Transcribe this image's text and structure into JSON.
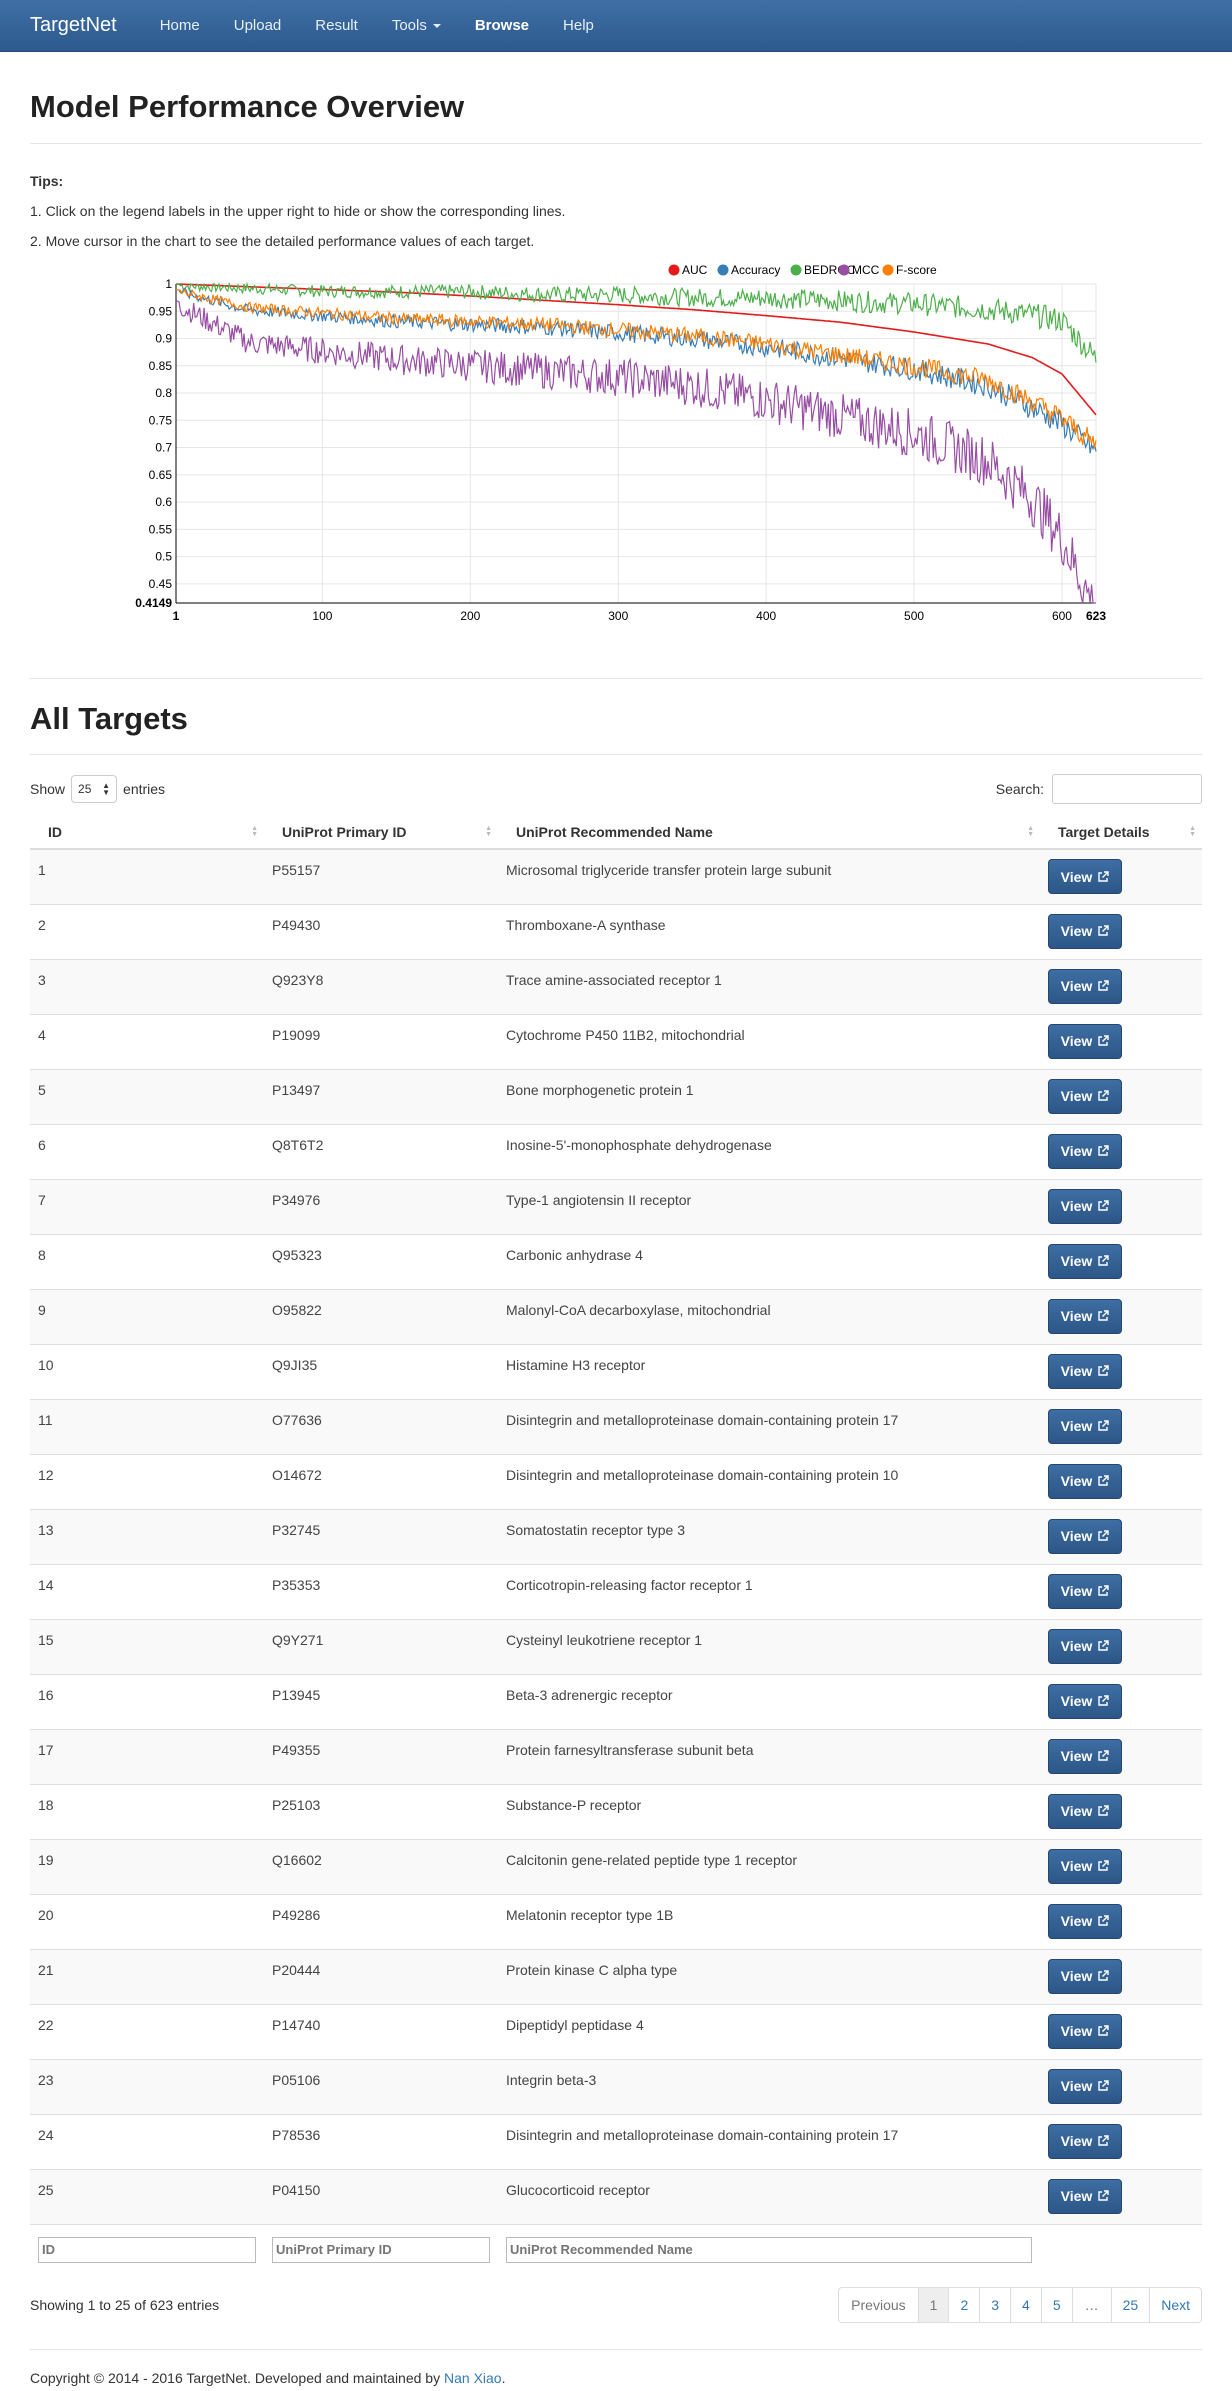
{
  "navbar": {
    "brand": "TargetNet",
    "items": [
      {
        "label": "Home"
      },
      {
        "label": "Upload"
      },
      {
        "label": "Result"
      },
      {
        "label": "Tools"
      },
      {
        "label": "Browse"
      },
      {
        "label": "Help"
      }
    ]
  },
  "overview": {
    "title": "Model Performance Overview",
    "tips_heading": "Tips:",
    "tips": [
      "1. Click on the legend labels in the upper right to hide or show the corresponding lines.",
      "2. Move cursor in the chart to see the detailed performance values of each target."
    ]
  },
  "chart_data": {
    "type": "line",
    "title": "",
    "xlabel": "",
    "ylabel": "",
    "x_range": [
      1,
      623
    ],
    "ylim": [
      0.4149,
      1
    ],
    "x_ticks": [
      "1",
      "100",
      "200",
      "300",
      "400",
      "500",
      "600",
      "623"
    ],
    "y_ticks": [
      "0.4149",
      "0.45",
      "0.5",
      "0.55",
      "0.6",
      "0.65",
      "0.7",
      "0.75",
      "0.8",
      "0.85",
      "0.9",
      "0.95",
      "1"
    ],
    "legend_position": "top-right",
    "grid": true,
    "series": [
      {
        "name": "AUC",
        "color": "#e41a1c",
        "x": [
          1,
          50,
          100,
          150,
          200,
          250,
          300,
          350,
          400,
          450,
          500,
          550,
          580,
          600,
          623
        ],
        "values": [
          1.0,
          0.995,
          0.99,
          0.985,
          0.978,
          0.97,
          0.962,
          0.953,
          0.942,
          0.93,
          0.912,
          0.89,
          0.865,
          0.835,
          0.76
        ]
      },
      {
        "name": "Accuracy",
        "color": "#377eb8",
        "x": [
          1,
          50,
          100,
          150,
          200,
          250,
          300,
          350,
          400,
          450,
          500,
          550,
          580,
          600,
          623
        ],
        "values": [
          0.99,
          0.955,
          0.945,
          0.935,
          0.93,
          0.925,
          0.915,
          0.905,
          0.89,
          0.87,
          0.85,
          0.82,
          0.78,
          0.75,
          0.7
        ]
      },
      {
        "name": "BEDROC",
        "color": "#4daf4a",
        "x": [
          1,
          50,
          100,
          150,
          200,
          250,
          300,
          350,
          400,
          450,
          500,
          550,
          580,
          600,
          623
        ],
        "values": [
          1.0,
          0.995,
          0.99,
          0.99,
          0.99,
          0.985,
          0.985,
          0.98,
          0.98,
          0.975,
          0.97,
          0.96,
          0.95,
          0.94,
          0.87
        ]
      },
      {
        "name": "MCC",
        "color": "#984ea3",
        "x": [
          1,
          50,
          100,
          150,
          200,
          250,
          300,
          350,
          400,
          450,
          500,
          550,
          580,
          600,
          623
        ],
        "values": [
          0.97,
          0.9,
          0.885,
          0.87,
          0.86,
          0.85,
          0.84,
          0.825,
          0.8,
          0.77,
          0.74,
          0.69,
          0.62,
          0.55,
          0.4149
        ]
      },
      {
        "name": "F-score",
        "color": "#ff7f00",
        "x": [
          1,
          50,
          100,
          150,
          200,
          250,
          300,
          350,
          400,
          450,
          500,
          550,
          580,
          600,
          623
        ],
        "values": [
          0.99,
          0.96,
          0.95,
          0.94,
          0.935,
          0.93,
          0.92,
          0.91,
          0.895,
          0.875,
          0.855,
          0.83,
          0.79,
          0.76,
          0.71
        ]
      }
    ]
  },
  "targets": {
    "title": "All Targets",
    "show_label": "Show",
    "entries_value": "25",
    "entries_label": "entries",
    "search_label": "Search:",
    "columns": [
      "ID",
      "UniProt Primary ID",
      "UniProt Recommended Name",
      "Target Details"
    ],
    "view_label": "View",
    "rows": [
      [
        "1",
        "P55157",
        "Microsomal triglyceride transfer protein large subunit"
      ],
      [
        "2",
        "P49430",
        "Thromboxane-A synthase"
      ],
      [
        "3",
        "Q923Y8",
        "Trace amine-associated receptor 1"
      ],
      [
        "4",
        "P19099",
        "Cytochrome P450 11B2, mitochondrial"
      ],
      [
        "5",
        "P13497",
        "Bone morphogenetic protein 1"
      ],
      [
        "6",
        "Q8T6T2",
        "Inosine-5'-monophosphate dehydrogenase"
      ],
      [
        "7",
        "P34976",
        "Type-1 angiotensin II receptor"
      ],
      [
        "8",
        "Q95323",
        "Carbonic anhydrase 4"
      ],
      [
        "9",
        "O95822",
        "Malonyl-CoA decarboxylase, mitochondrial"
      ],
      [
        "10",
        "Q9JI35",
        "Histamine H3 receptor"
      ],
      [
        "11",
        "O77636",
        "Disintegrin and metalloproteinase domain-containing protein 17"
      ],
      [
        "12",
        "O14672",
        "Disintegrin and metalloproteinase domain-containing protein 10"
      ],
      [
        "13",
        "P32745",
        "Somatostatin receptor type 3"
      ],
      [
        "14",
        "P35353",
        "Corticotropin-releasing factor receptor 1"
      ],
      [
        "15",
        "Q9Y271",
        "Cysteinyl leukotriene receptor 1"
      ],
      [
        "16",
        "P13945",
        "Beta-3 adrenergic receptor"
      ],
      [
        "17",
        "P49355",
        "Protein farnesyltransferase subunit beta"
      ],
      [
        "18",
        "P25103",
        "Substance-P receptor"
      ],
      [
        "19",
        "Q16602",
        "Calcitonin gene-related peptide type 1 receptor"
      ],
      [
        "20",
        "P49286",
        "Melatonin receptor type 1B"
      ],
      [
        "21",
        "P20444",
        "Protein kinase C alpha type"
      ],
      [
        "22",
        "P14740",
        "Dipeptidyl peptidase 4"
      ],
      [
        "23",
        "P05106",
        "Integrin beta-3"
      ],
      [
        "24",
        "P78536",
        "Disintegrin and metalloproteinase domain-containing protein 17"
      ],
      [
        "25",
        "P04150",
        "Glucocorticoid receptor"
      ]
    ],
    "footer_placeholders": [
      "ID",
      "UniProt Primary ID",
      "UniProt Recommended Name"
    ],
    "info": "Showing 1 to 25 of 623 entries",
    "pagination": {
      "previous": "Previous",
      "pages": [
        "1",
        "2",
        "3",
        "4",
        "5",
        "…",
        "25"
      ],
      "next": "Next"
    }
  },
  "footer": {
    "text": "Copyright © 2014 - 2016 TargetNet. Developed and maintained by",
    "author": "Nan Xiao",
    "end": "."
  }
}
